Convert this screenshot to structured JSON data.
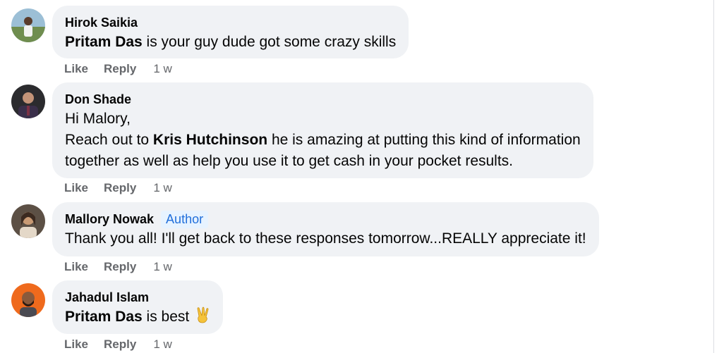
{
  "actions": {
    "like": "Like",
    "reply": "Reply"
  },
  "comments": [
    {
      "author": "Hirok Saikia",
      "mention": "Pritam Das",
      "text_after": " is your guy dude got some crazy skills",
      "time": "1 w"
    },
    {
      "author": "Don Shade",
      "line1": "Hi Malory,",
      "line2_before": "Reach out to ",
      "mention": "Kris Hutchinson",
      "line2_after": " he is amazing at putting this kind of information",
      "line3": "together as well as help you use it to get cash in your pocket results.",
      "time": "1 w"
    },
    {
      "author": "Mallory Nowak",
      "badge": "Author",
      "text": "Thank you all! I'll get back to these responses tomorrow...REALLY appreciate it!",
      "time": "1 w"
    },
    {
      "author": "Jahadul Islam",
      "mention": "Pritam Das",
      "text_after": " is best ",
      "emoji": "victory-hand-icon",
      "time": "1 w"
    }
  ]
}
